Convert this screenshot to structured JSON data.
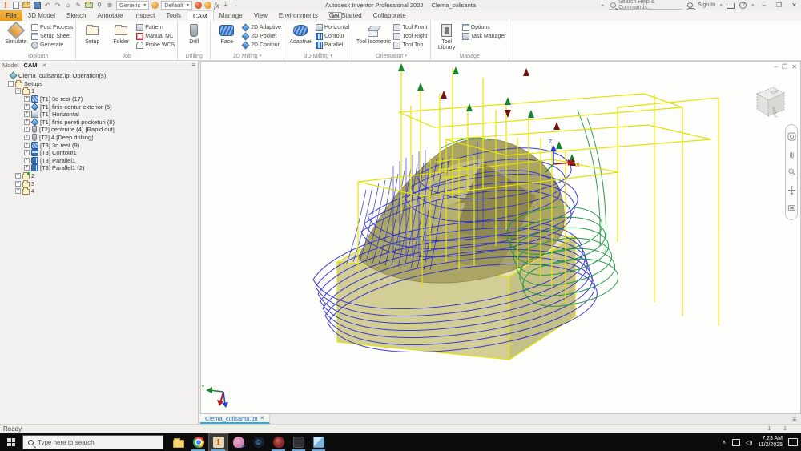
{
  "titlebar": {
    "app_title": "Autodesk Inventor Professional 2022",
    "doc_title": "Clema_culisanta",
    "search_placeholder": "Search Help & Commands...",
    "sign_in": "Sign In",
    "help_glyph": "?",
    "material_select": "Generic",
    "appearance_select": "Default",
    "fx_label": "fx",
    "window_controls": {
      "minimize": "–",
      "restore": "❐",
      "close": "✕"
    }
  },
  "tabs": [
    {
      "label": "File",
      "active": false,
      "file": true
    },
    {
      "label": "3D Model",
      "active": false
    },
    {
      "label": "Sketch",
      "active": false
    },
    {
      "label": "Annotate",
      "active": false
    },
    {
      "label": "Inspect",
      "active": false
    },
    {
      "label": "Tools",
      "active": false
    },
    {
      "label": "CAM",
      "active": true
    },
    {
      "label": "Manage",
      "active": false
    },
    {
      "label": "View",
      "active": false
    },
    {
      "label": "Environments",
      "active": false
    },
    {
      "label": "Get Started",
      "active": false
    },
    {
      "label": "Collaborate",
      "active": false
    }
  ],
  "ribbon": {
    "groups": [
      {
        "label": "Toolpath",
        "big": [
          "Simulate"
        ],
        "small": [
          "Post Process",
          "Setup Sheet",
          "Generate"
        ]
      },
      {
        "label": "Job",
        "big": [
          "Setup",
          "Folder"
        ],
        "small": [
          "Pattern",
          "Manual NC",
          "Probe WCS"
        ]
      },
      {
        "label": "Drilling",
        "big": [
          "Drill"
        ],
        "small": []
      },
      {
        "label": "2D Milling",
        "big": [
          "Face"
        ],
        "small": [
          "2D Adaptive",
          "2D Pocket",
          "2D Contour"
        ]
      },
      {
        "label": "3D Milling",
        "big": [
          "Adaptive"
        ],
        "small": [
          "Horizontal",
          "Contour",
          "Parallel"
        ]
      },
      {
        "label": "Orientation",
        "big": [
          "Tool Isometric"
        ],
        "small": [
          "Tool Front",
          "Tool Right",
          "Tool Top"
        ]
      },
      {
        "label": "Manage",
        "big": [
          "Tool Library"
        ],
        "small": [
          "Options",
          "Task Manager"
        ]
      }
    ]
  },
  "browser": {
    "tab_model": "Model",
    "tab_cam": "CAM",
    "close_glyph": "✕",
    "tree": [
      {
        "label": "Clema_culisanta.ipt Operation(s)",
        "level": 0,
        "icon": "root",
        "expand": "none"
      },
      {
        "label": "Setups",
        "level": 1,
        "icon": "folder",
        "expand": "minus"
      },
      {
        "label": "1",
        "level": 2,
        "icon": "setup",
        "expand": "minus"
      },
      {
        "label": "[T1] 3d rest (17)",
        "level": 3,
        "icon": "adaptive",
        "expand": "plus"
      },
      {
        "label": "[T1] finis contur exterior (5)",
        "level": 3,
        "icon": "contour2d",
        "expand": "plus"
      },
      {
        "label": "[T1] Horizontal",
        "level": 3,
        "icon": "horizontal",
        "expand": "plus"
      },
      {
        "label": "[T1] finis pereti pocketuri (8)",
        "level": 3,
        "icon": "contour2d",
        "expand": "plus"
      },
      {
        "label": "[T2] centruire (4) [Rapid out]",
        "level": 3,
        "icon": "drill",
        "expand": "plus"
      },
      {
        "label": "[T2] 4 [Deep drilling]",
        "level": 3,
        "icon": "drill",
        "expand": "plus"
      },
      {
        "label": "[T3] 3d rest (9)",
        "level": 3,
        "icon": "adaptive",
        "expand": "plus"
      },
      {
        "label": "[T3] Contour1",
        "level": 3,
        "icon": "contour",
        "expand": "plus"
      },
      {
        "label": "[T3] Parallel1",
        "level": 3,
        "icon": "parallel",
        "expand": "plus"
      },
      {
        "label": "[T3] Parallel1 (2)",
        "level": 3,
        "icon": "parallel",
        "expand": "plus"
      },
      {
        "label": "2",
        "level": 2,
        "icon": "setup2",
        "expand": "plus"
      },
      {
        "label": "3",
        "level": 2,
        "icon": "setup",
        "expand": "plus"
      },
      {
        "label": "4",
        "level": 2,
        "icon": "setup",
        "expand": "plus"
      }
    ]
  },
  "viewport": {
    "viewcube_top": "TOP",
    "viewcube_right": "RIGHT",
    "axis_z": "Z",
    "axis_x": "X",
    "axis_y": "Y",
    "colors": {
      "rapid": "#e8e50a",
      "cutting": "#2a2ad4",
      "lead": "#15923a",
      "stock": "#c9c37e",
      "part": "#aaa465"
    }
  },
  "doctabs": {
    "active_doc": "Clema_culisanta.ipt",
    "close_glyph": "✕"
  },
  "status": {
    "ready": "Ready",
    "marker1": "1",
    "marker2": "1"
  },
  "taskbar": {
    "search_placeholder": "Type here to search",
    "apps": [
      {
        "name": "taskbar-app-file-explorer",
        "icon": "explorer",
        "running": false,
        "active": false
      },
      {
        "name": "taskbar-app-chrome",
        "icon": "chrome",
        "running": true,
        "active": false
      },
      {
        "name": "taskbar-app-inventor",
        "icon": "inventor",
        "running": true,
        "active": true,
        "glyph": "I"
      },
      {
        "name": "taskbar-app-pink",
        "icon": "pinkapp",
        "running": false,
        "active": false
      },
      {
        "name": "taskbar-app-copyright",
        "icon": "ccirc",
        "running": false,
        "active": false,
        "glyph": "©"
      },
      {
        "name": "taskbar-app-red",
        "icon": "redapp",
        "running": true,
        "active": false
      },
      {
        "name": "taskbar-app-dark",
        "icon": "darkapp",
        "running": true,
        "active": false
      },
      {
        "name": "taskbar-app-blue",
        "icon": "blueapp",
        "running": true,
        "active": false
      }
    ],
    "tray": {
      "time": "7:23 AM",
      "date": "11/2/2025"
    }
  }
}
